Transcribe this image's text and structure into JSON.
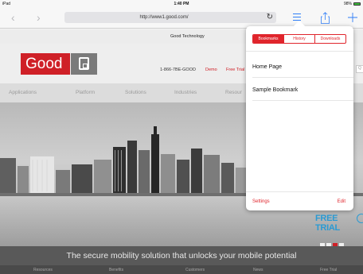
{
  "status": {
    "device": "iPad",
    "time": "1:40 PM",
    "battery": "98%"
  },
  "browser": {
    "url": "http://www1.good.com/"
  },
  "site": {
    "company": "Good Technology",
    "logo_text": "Good",
    "phone": "1-866-7BE-GOOD",
    "demo": "Demo",
    "free_trial": "Free Trial",
    "nav": [
      "Applications",
      "Platform",
      "Solutions",
      "Industries",
      "Resour"
    ],
    "hero_cta": "FREE TRIAL",
    "tagline": "The secure mobility solution that unlocks your mobile potential",
    "footer": [
      "Resources",
      "Benefits",
      "Customers",
      "News",
      "Free Trial"
    ],
    "colors": {
      "brand_red": "#cf2027",
      "cta_blue": "#2a9ad3"
    }
  },
  "popover": {
    "tabs": [
      "Bookmarks",
      "History",
      "Downloads"
    ],
    "active_tab": "Bookmarks",
    "items": [
      "Home Page",
      "Sample Bookmark"
    ],
    "settings": "Settings",
    "edit": "Edit",
    "accent": "#e0252c"
  }
}
